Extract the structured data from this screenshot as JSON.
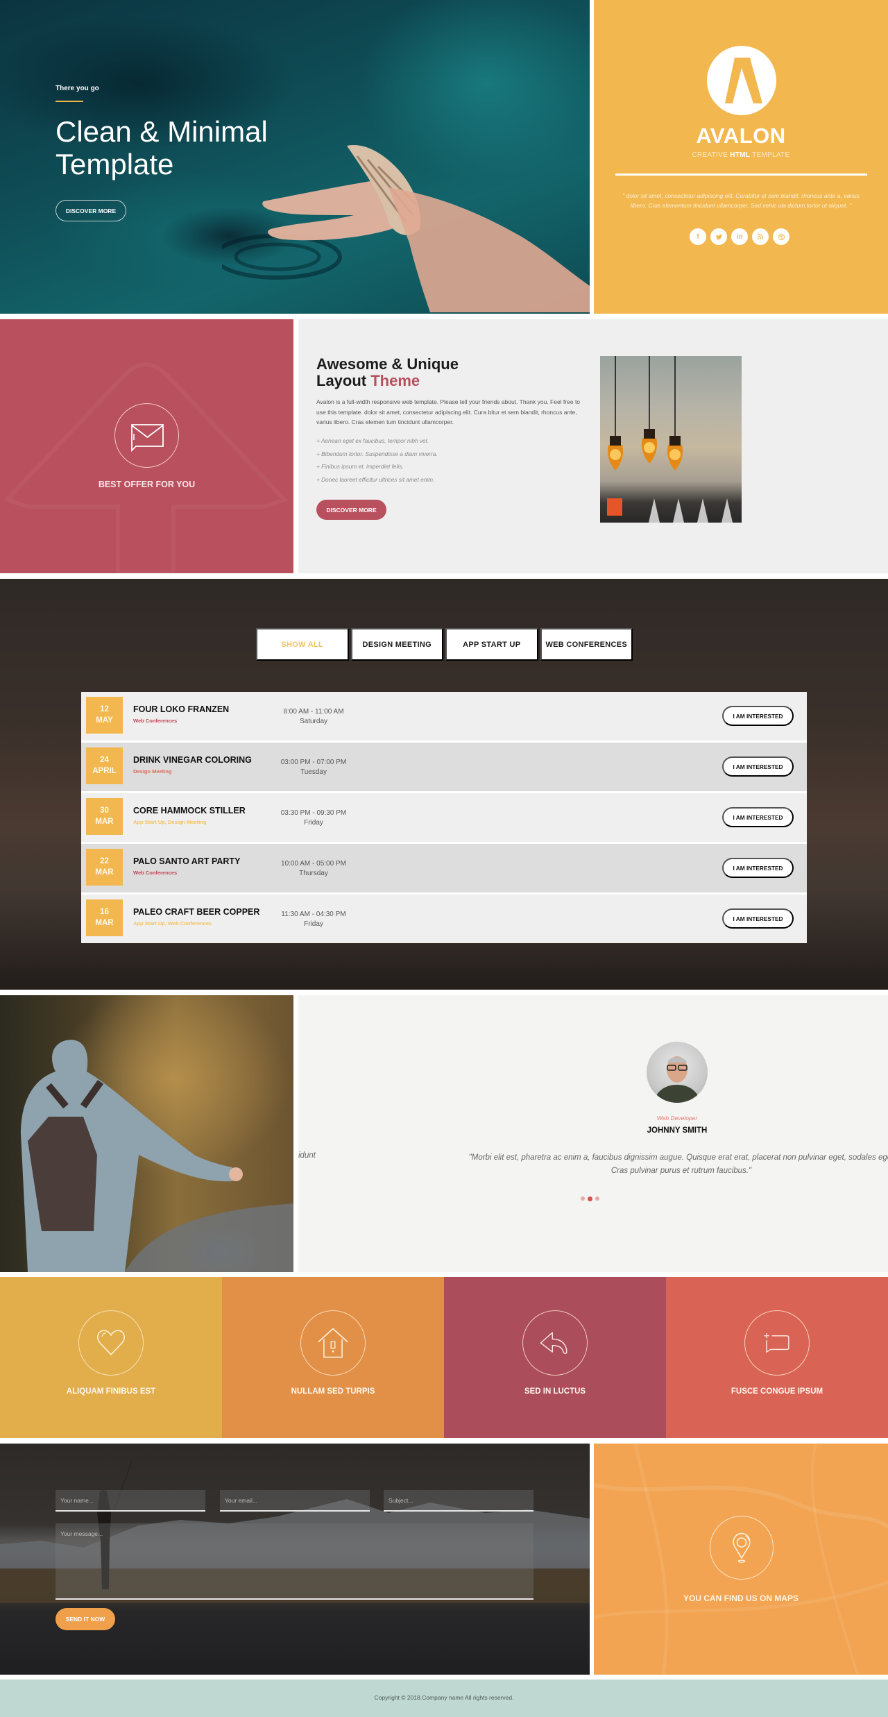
{
  "hero": {
    "eyebrow": "There you go",
    "title": "Clean & Minimal Template",
    "button": "DISCOVER MORE"
  },
  "brand": {
    "logo_letter": "A",
    "name": "AVALON",
    "sub_before": "CREATIVE ",
    "sub_bold": "HTML",
    "sub_after": " TEMPLATE",
    "quote": "\" dolor sit amet, consectetur adipiscing elit. Curabitur et sem blandit, rhoncus ante a, varius libero. Cras elementum tincidunt ullamcorper. Sed vehic ula dictum tortor ut aliquet. \"",
    "socials": [
      {
        "icon": "facebook-icon",
        "glyph": "f"
      },
      {
        "icon": "twitter-icon",
        "glyph": "t"
      },
      {
        "icon": "linkedin-icon",
        "glyph": "in"
      },
      {
        "icon": "rss-icon",
        "glyph": "◔"
      },
      {
        "icon": "dribbble-icon",
        "glyph": "◎"
      }
    ],
    "color": "#f2b84f"
  },
  "offer": {
    "icon": "envelope-chat-icon",
    "title": "BEST OFFER FOR YOU",
    "color": "#b9505e"
  },
  "about": {
    "title_line1": "Awesome & Unique",
    "title_line2": "Layout ",
    "title_accent": "Theme",
    "body": "Avalon is a full-width responsive web template. Please tell your friends about. Thank you. Feel free to use this template. dolor sit amet, consectetur adipiscing elit. Cura bitur et sem blandit, rhoncus ante, varius libero. Cras elemen tum tincidunt ullamcorper.",
    "list": [
      "+ Aenean eget ex faucibus, tempor nibh vel.",
      "+ Bibendum tortor. Suspendisse a diam viverra.",
      "+ Finibus ipsum et, imperdiet felis.",
      "+ Donec laoreet efficitur ultrices sit amet enim."
    ],
    "button": "DISCOVER MORE"
  },
  "events": {
    "filters": [
      {
        "label": "SHOW ALL",
        "active": true
      },
      {
        "label": "DESIGN MEETING",
        "active": false
      },
      {
        "label": "APP START UP",
        "active": false
      },
      {
        "label": "WEB CONFERENCES",
        "active": false
      }
    ],
    "items": [
      {
        "day": "12",
        "month": "MAY",
        "name": "FOUR LOKO FRANZEN",
        "category": "Web Conferences",
        "category_color": "#c0485a",
        "time": "8:00 AM - 11:00 AM",
        "weekday": "Saturday",
        "button": "I AM INTERESTED"
      },
      {
        "day": "24",
        "month": "APRIL",
        "name": "DRINK VINEGAR COLORING",
        "category": "Design Meeting",
        "category_color": "#e06a5a",
        "time": "03:00 PM - 07:00 PM",
        "weekday": "Tuesday",
        "button": "I AM INTERESTED"
      },
      {
        "day": "30",
        "month": "MAR",
        "name": "CORE HAMMOCK STILLER",
        "category": "App Start Up, Design Meeting",
        "category_color": "#f2c35f",
        "time": "03:30 PM - 09:30 PM",
        "weekday": "Friday",
        "button": "I AM INTERESTED"
      },
      {
        "day": "22",
        "month": "MAR",
        "name": "PALO SANTO ART PARTY",
        "category": "Web Conferences",
        "category_color": "#c0485a",
        "time": "10:00 AM - 05:00 PM",
        "weekday": "Thursday",
        "button": "I AM INTERESTED"
      },
      {
        "day": "16",
        "month": "MAR",
        "name": "PALEO CRAFT BEER COPPER",
        "category": "App Start Up, Web Conferences",
        "category_color": "#f2c35f",
        "time": "11:30 AM - 04:30 PM",
        "weekday": "Friday",
        "button": "I AM INTERESTED"
      }
    ]
  },
  "testimonial": {
    "role": "Web Developer",
    "name": "JOHNNY SMITH",
    "quote_line1": "\"Morbi elit est, pharetra ac enim a, faucibus dignissim augue. Quisque erat erat, placerat non pulvinar eget, sodales eget",
    "quote_line2": "Cras pulvinar purus et rutrum faucibus.\"",
    "prev_fragment": "idunt",
    "slides": 3,
    "active_slide": 2
  },
  "features": [
    {
      "title": "ALIQUAM FINIBUS EST",
      "icon": "heart-icon",
      "color": "#e2ae4c"
    },
    {
      "title": "NULLAM SED TURPIS",
      "icon": "house-icon",
      "color": "#e29047"
    },
    {
      "title": "SED IN LUCTUS",
      "icon": "reply-arrow-icon",
      "color": "#ab4d5b"
    },
    {
      "title": "FUSCE CONGUE IPSUM",
      "icon": "chat-bubble-icon",
      "color": "#d96456"
    }
  ],
  "contact": {
    "name_placeholder": "Your name...",
    "email_placeholder": "Your email...",
    "subject_placeholder": "Subject...",
    "message_placeholder": "Your message...",
    "button": "SEND IT NOW"
  },
  "maps": {
    "icon": "map-pin-icon",
    "title": "YOU CAN FIND US ON MAPS"
  },
  "footer": {
    "copyright": "Copyright © 2018.Company name All rights reserved."
  }
}
